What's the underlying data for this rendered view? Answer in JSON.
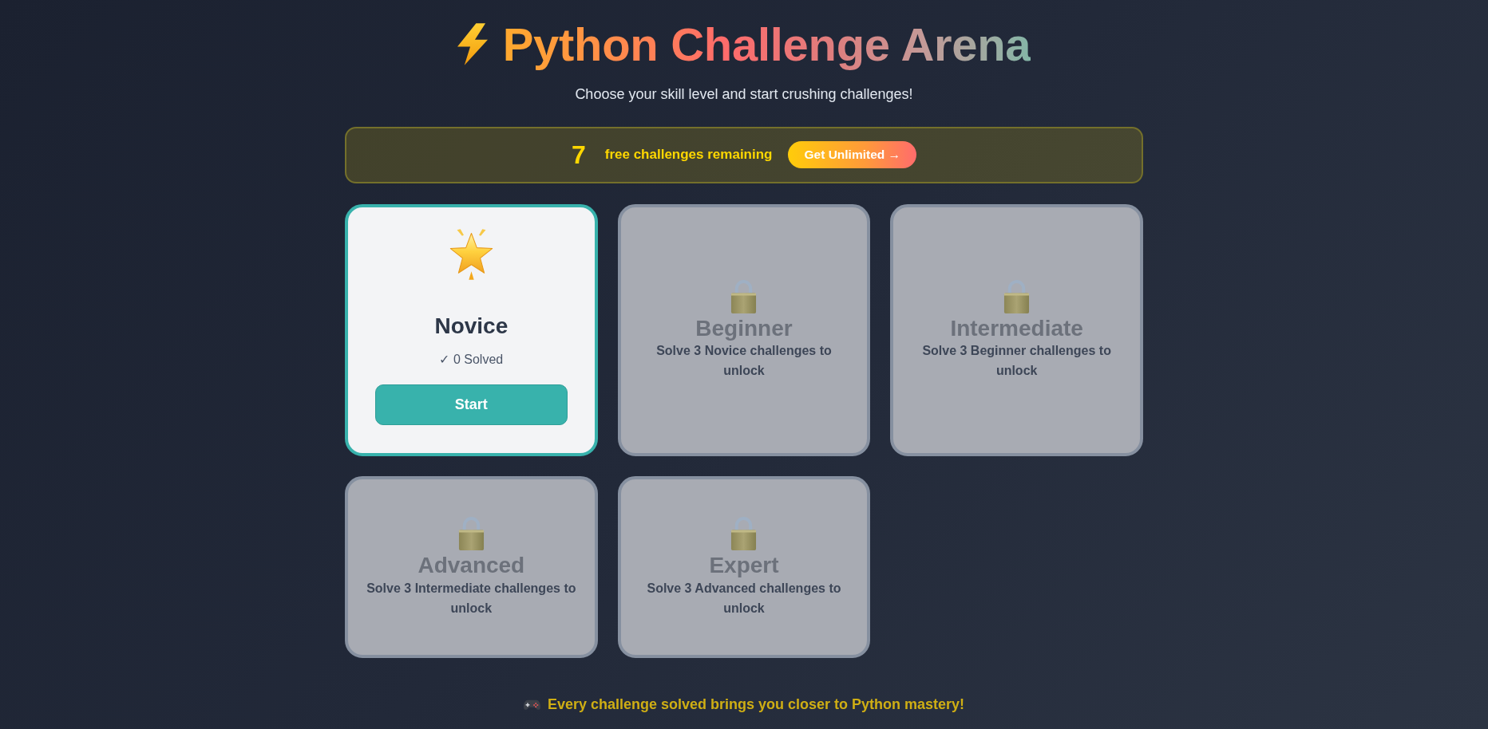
{
  "header": {
    "title": "Python Challenge Arena",
    "subtitle": "Choose your skill level and start crushing challenges!"
  },
  "banner": {
    "count": "7",
    "text": "free challenges remaining",
    "button": "Get Unlimited →"
  },
  "levels": [
    {
      "name": "Novice",
      "locked": false,
      "solved": "✓ 0 Solved",
      "button": "Start"
    },
    {
      "name": "Beginner",
      "locked": true,
      "requirement": "Solve 3 Novice challenges to unlock"
    },
    {
      "name": "Intermediate",
      "locked": true,
      "requirement": "Solve 3 Beginner challenges to unlock"
    },
    {
      "name": "Advanced",
      "locked": true,
      "requirement": "Solve 3 Intermediate challenges to unlock"
    },
    {
      "name": "Expert",
      "locked": true,
      "requirement": "Solve 3 Advanced challenges to unlock"
    }
  ],
  "footer": {
    "text": "Every challenge solved brings you closer to Python mastery!"
  }
}
